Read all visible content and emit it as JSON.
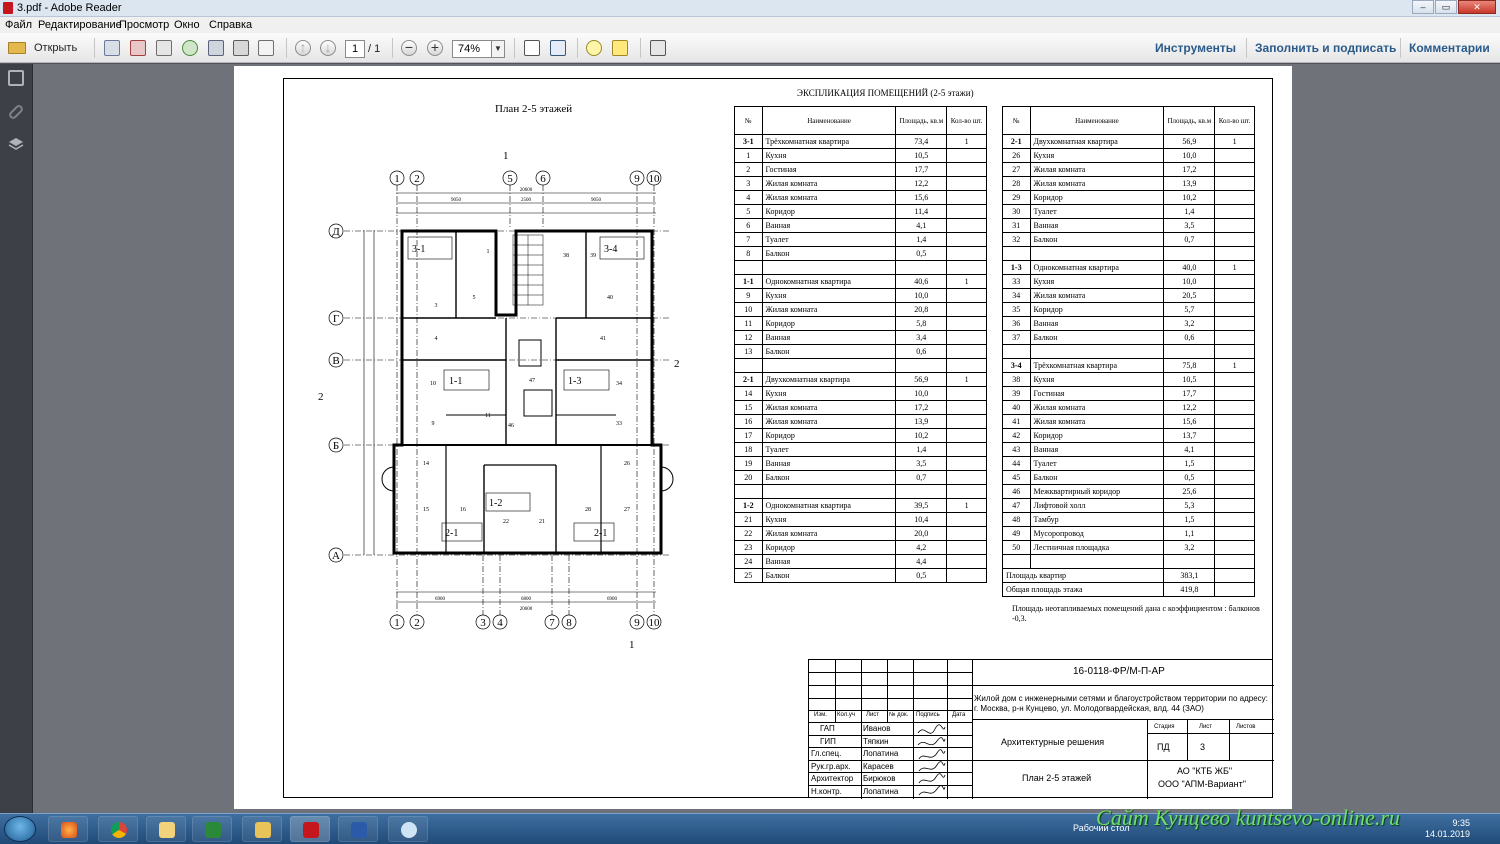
{
  "window": {
    "title": "3.pdf - Adobe Reader"
  },
  "menu": [
    "Файл",
    "Редактирование",
    "Просмотр",
    "Окно",
    "Справка"
  ],
  "toolbar": {
    "open_label": "Открыть",
    "page_current": "1",
    "page_total": "/ 1",
    "zoom": "74%",
    "tools_label": "Инструменты",
    "fill_sign_label": "Заполнить и подписать",
    "comments_label": "Комментарии"
  },
  "drawing": {
    "plan_title": "План 2-5 этажей",
    "section_marks": [
      "1",
      "1",
      "2",
      "2"
    ],
    "grid_top": [
      "1",
      "2",
      "5",
      "6",
      "9",
      "10"
    ],
    "grid_bottom": [
      "1",
      "2",
      "3",
      "4",
      "7",
      "8",
      "9",
      "10"
    ],
    "grid_rows": [
      "Д",
      "Г",
      "В",
      "Б",
      "А"
    ],
    "dims_top": [
      "20600",
      "9050",
      "2500",
      "9050"
    ],
    "dims_bottom": [
      "6900",
      "6800",
      "6900",
      "20600"
    ],
    "apartment_tags": [
      "3-1",
      "3-4",
      "1-1",
      "1-3",
      "1-2",
      "2-1",
      "2-1"
    ],
    "room_numbers": [
      "1",
      "3",
      "4",
      "5",
      "9",
      "10",
      "11",
      "14",
      "15",
      "16",
      "22",
      "21",
      "27",
      "28",
      "33",
      "34",
      "38",
      "39",
      "40",
      "41",
      "46",
      "47",
      "26"
    ]
  },
  "explication": {
    "title": "ЭКСПЛИКАЦИЯ ПОМЕЩЕНИЙ (2-5 этажи)",
    "headers": {
      "num": "№",
      "name": "Наименование",
      "area": "Площадь, кв.м",
      "count": "Кол-во шт."
    },
    "left_rows": [
      [
        "3-1",
        "Трёхкомнатная квартира",
        "73,4",
        "1"
      ],
      [
        "1",
        "Кухня",
        "10,5",
        ""
      ],
      [
        "2",
        "Гостиная",
        "17,7",
        ""
      ],
      [
        "3",
        "Жилая комната",
        "12,2",
        ""
      ],
      [
        "4",
        "Жилая комната",
        "15,6",
        ""
      ],
      [
        "5",
        "Коридор",
        "11,4",
        ""
      ],
      [
        "6",
        "Ванная",
        "4,1",
        ""
      ],
      [
        "7",
        "Туалет",
        "1,4",
        ""
      ],
      [
        "8",
        "Балкон",
        "0,5",
        ""
      ],
      [
        "",
        "",
        "",
        ""
      ],
      [
        "1-1",
        "Однокомнатная квартира",
        "40,6",
        "1"
      ],
      [
        "9",
        "Кухня",
        "10,0",
        ""
      ],
      [
        "10",
        "Жилая комната",
        "20,8",
        ""
      ],
      [
        "11",
        "Коридор",
        "5,8",
        ""
      ],
      [
        "12",
        "Ванная",
        "3,4",
        ""
      ],
      [
        "13",
        "Балкон",
        "0,6",
        ""
      ],
      [
        "",
        "",
        "",
        ""
      ],
      [
        "2-1",
        "Двухкомнатная квартира",
        "56,9",
        "1"
      ],
      [
        "14",
        "Кухня",
        "10,0",
        ""
      ],
      [
        "15",
        "Жилая комната",
        "17,2",
        ""
      ],
      [
        "16",
        "Жилая комната",
        "13,9",
        ""
      ],
      [
        "17",
        "Коридор",
        "10,2",
        ""
      ],
      [
        "18",
        "Туалет",
        "1,4",
        ""
      ],
      [
        "19",
        "Ванная",
        "3,5",
        ""
      ],
      [
        "20",
        "Балкон",
        "0,7",
        ""
      ],
      [
        "",
        "",
        "",
        ""
      ],
      [
        "1-2",
        "Однокомнатная квартира",
        "39,5",
        "1"
      ],
      [
        "21",
        "Кухня",
        "10,4",
        ""
      ],
      [
        "22",
        "Жилая комната",
        "20,0",
        ""
      ],
      [
        "23",
        "Коридор",
        "4,2",
        ""
      ],
      [
        "24",
        "Ванная",
        "4,4",
        ""
      ],
      [
        "25",
        "Балкон",
        "0,5",
        ""
      ]
    ],
    "right_rows": [
      [
        "2-1",
        "Двухкомнатная квартира",
        "56,9",
        "1"
      ],
      [
        "26",
        "Кухня",
        "10,0",
        ""
      ],
      [
        "27",
        "Жилая комната",
        "17,2",
        ""
      ],
      [
        "28",
        "Жилая комната",
        "13,9",
        ""
      ],
      [
        "29",
        "Коридор",
        "10,2",
        ""
      ],
      [
        "30",
        "Туалет",
        "1,4",
        ""
      ],
      [
        "31",
        "Ванная",
        "3,5",
        ""
      ],
      [
        "32",
        "Балкон",
        "0,7",
        ""
      ],
      [
        "",
        "",
        "",
        ""
      ],
      [
        "1-3",
        "Однокомнатная квартира",
        "40,0",
        "1"
      ],
      [
        "33",
        "Кухня",
        "10,0",
        ""
      ],
      [
        "34",
        "Жилая комната",
        "20,5",
        ""
      ],
      [
        "35",
        "Коридор",
        "5,7",
        ""
      ],
      [
        "36",
        "Ванная",
        "3,2",
        ""
      ],
      [
        "37",
        "Балкон",
        "0,6",
        ""
      ],
      [
        "",
        "",
        "",
        ""
      ],
      [
        "3-4",
        "Трёхкомнатная квартира",
        "75,8",
        "1"
      ],
      [
        "38",
        "Кухня",
        "10,5",
        ""
      ],
      [
        "39",
        "Гостиная",
        "17,7",
        ""
      ],
      [
        "40",
        "Жилая комната",
        "12,2",
        ""
      ],
      [
        "41",
        "Жилая комната",
        "15,6",
        ""
      ],
      [
        "42",
        "Коридор",
        "13,7",
        ""
      ],
      [
        "43",
        "Ванная",
        "4,1",
        ""
      ],
      [
        "44",
        "Туалет",
        "1,5",
        ""
      ],
      [
        "45",
        "Балкон",
        "0,5",
        ""
      ],
      [
        "46",
        "Межквартирный коридор",
        "25,6",
        ""
      ],
      [
        "47",
        "Лифтовой холл",
        "5,3",
        ""
      ],
      [
        "48",
        "Тамбур",
        "1,5",
        ""
      ],
      [
        "49",
        "Мусоропровод",
        "1,1",
        ""
      ],
      [
        "50",
        "Лестничная площадка",
        "3,2",
        ""
      ],
      [
        "",
        "",
        "",
        ""
      ]
    ],
    "summary": [
      [
        "Площадь квартир",
        "383,1"
      ],
      [
        "Общая площадь этажа",
        "419,8"
      ]
    ],
    "note": "Площадь неотапливаемых помещений дана с коэффициентом : балконов -0,3."
  },
  "stamp": {
    "code": "16-0118-ФР/М-П-АР",
    "project": "Жилой дом с инженерными сетями и благоустройством территории по адресу: г. Москва, р-н Кунцево, ул. Молодогвардейская, влд. 44 (ЗАО)",
    "col_heads": [
      "Изм.",
      "Кол.уч",
      "Лист",
      "№ док.",
      "Подпись",
      "Дата"
    ],
    "roles": [
      [
        "ГАП",
        "Иванов"
      ],
      [
        "ГИП",
        "Тяпкин"
      ],
      [
        "Гл.спец.",
        "Лопатина"
      ],
      [
        "Рук.гр.арх.",
        "Карасев"
      ],
      [
        "Архитектор",
        "Бирюков"
      ],
      [
        "Н.контр.",
        "Лопатина"
      ]
    ],
    "section": "Архитектурные решения",
    "stage_head": "Стадия",
    "sheet_head": "Лист",
    "sheets_head": "Листов",
    "stage": "ПД",
    "sheet": "3",
    "sheets": "",
    "sheet_title": "План 2-5 этажей",
    "org": [
      "АО \"КТБ ЖБ\"",
      "ООО \"АПМ-Вариант\""
    ]
  },
  "taskbar": {
    "desktop_label": "Рабочий стол",
    "time": "9:35",
    "date": "14.01.2019"
  },
  "watermark": "Сайт Кунцево  kuntsevo-online.ru"
}
